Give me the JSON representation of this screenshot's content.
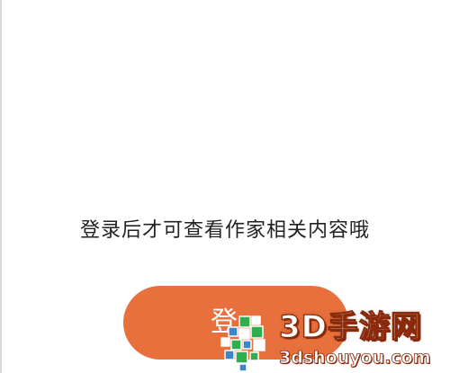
{
  "main": {
    "prompt_text": "登录后才可查看作家相关内容哦",
    "login_button_label": "登"
  },
  "watermark": {
    "brand": "3D手游网",
    "url": "3dshouyou.com"
  },
  "colors": {
    "background": "#ffffff",
    "prompt_text": "#222222",
    "login_button": "#e8703c",
    "watermark_green": "#2fae4e",
    "watermark_blue": "#3a86c8",
    "watermark_stroke": "#8a2a0a"
  },
  "icons": {
    "watermark_logo": "pixel-mosaic-logo-icon"
  }
}
